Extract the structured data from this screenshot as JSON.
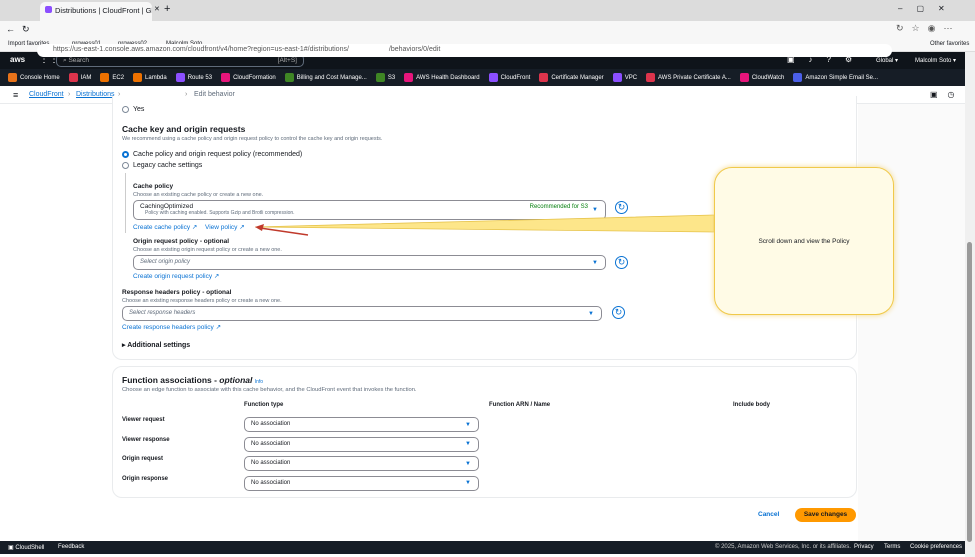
{
  "browser": {
    "tab_title": "Distributions | CloudFront | Glob...",
    "url_prefix": "https://us-east-1.console.aws.amazon.com/cloudfront/v4/home?region=us-east-1#/distributions/",
    "url_suffix": "/behaviors/0/edit",
    "favorites": [
      "Import favorites",
      "prowess01",
      "prowess02",
      "Malcolm Soto"
    ],
    "other_favorites": "Other favorites"
  },
  "aws_nav": {
    "search_placeholder": "Search",
    "search_shortcut": "[Alt+S]",
    "region": "Global ▾",
    "user": "Malcolm Soto ▾"
  },
  "services": [
    {
      "label": "Console Home",
      "color": "#e8731a"
    },
    {
      "label": "IAM",
      "color": "#dd344c"
    },
    {
      "label": "EC2",
      "color": "#ed7100"
    },
    {
      "label": "Lambda",
      "color": "#ed7100"
    },
    {
      "label": "Route 53",
      "color": "#8c4fff"
    },
    {
      "label": "CloudFormation",
      "color": "#e7157b"
    },
    {
      "label": "Billing and Cost Manage...",
      "color": "#3f8624"
    },
    {
      "label": "S3",
      "color": "#3f8624"
    },
    {
      "label": "AWS Health Dashboard",
      "color": "#e7157b"
    },
    {
      "label": "CloudFront",
      "color": "#8c4fff"
    },
    {
      "label": "Certificate Manager",
      "color": "#dd344c"
    },
    {
      "label": "VPC",
      "color": "#8c4fff"
    },
    {
      "label": "AWS Private Certificate A...",
      "color": "#dd344c"
    },
    {
      "label": "CloudWatch",
      "color": "#e7157b"
    },
    {
      "label": "Amazon Simple Email Se...",
      "color": "#4b5fe8"
    }
  ],
  "breadcrumb": {
    "items": [
      "CloudFront",
      "Distributions"
    ],
    "current": "Edit behavior"
  },
  "form": {
    "yes_option": "Yes",
    "cache_title": "Cache key and origin requests",
    "cache_desc": "We recommend using a cache policy and origin request policy to control the cache key and origin requests.",
    "opt_recommended": "Cache policy and origin request policy (recommended)",
    "opt_legacy": "Legacy cache settings",
    "cache_policy": {
      "label": "Cache policy",
      "hint": "Choose an existing cache policy or create a new one.",
      "value": "CachingOptimized",
      "desc": "Policy with caching enabled. Supports Gzip and Brotli compression.",
      "badge": "Recommended for S3",
      "create": "Create cache policy",
      "view": "View policy"
    },
    "origin_policy": {
      "label": "Origin request policy - optional",
      "hint": "Choose an existing origin request policy or create a new one.",
      "placeholder": "Select origin policy",
      "create": "Create origin request policy"
    },
    "response_policy": {
      "label": "Response headers policy - optional",
      "hint": "Choose an existing response headers policy or create a new one.",
      "placeholder": "Select response headers",
      "create": "Create response headers policy"
    },
    "additional": "Additional settings"
  },
  "functions": {
    "title": "Function associations - ",
    "title_em": "optional",
    "info": "Info",
    "desc": "Choose an edge function to associate with this cache behavior, and the CloudFront event that invokes the function.",
    "col_type": "Function type",
    "col_arn": "Function ARN / Name",
    "col_body": "Include body",
    "rows": [
      {
        "label": "Viewer request",
        "value": "No association"
      },
      {
        "label": "Viewer response",
        "value": "No association"
      },
      {
        "label": "Origin request",
        "value": "No association"
      },
      {
        "label": "Origin response",
        "value": "No association"
      }
    ]
  },
  "actions": {
    "cancel": "Cancel",
    "save": "Save changes"
  },
  "callout": {
    "text": "Scroll down and view the Policy"
  },
  "footer": {
    "cloudshell": "CloudShell",
    "feedback": "Feedback",
    "copyright": "© 2025, Amazon Web Services, Inc. or its affiliates.",
    "privacy": "Privacy",
    "terms": "Terms",
    "cookies": "Cookie preferences"
  }
}
